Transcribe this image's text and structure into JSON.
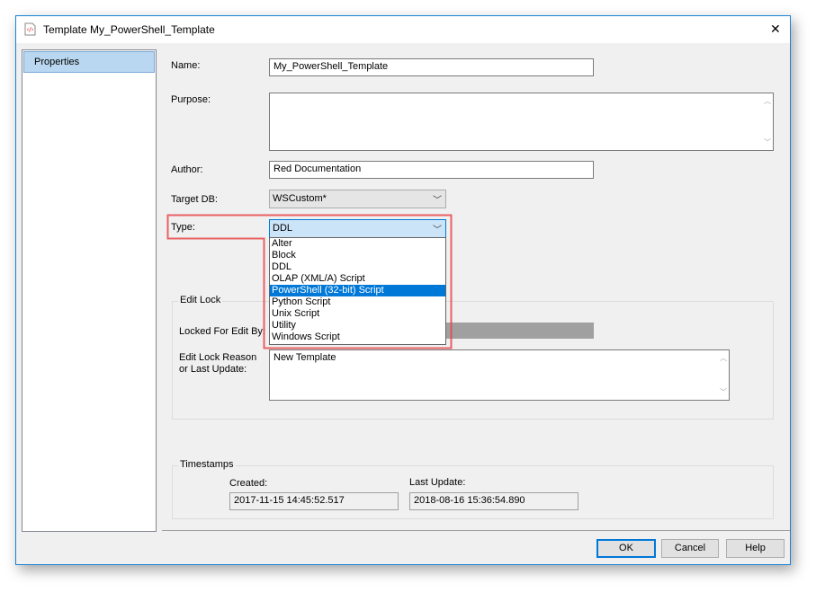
{
  "window": {
    "title": "Template My_PowerShell_Template",
    "close": "✕"
  },
  "sidebar": {
    "items": [
      {
        "label": "Properties"
      }
    ]
  },
  "form": {
    "name_label": "Name:",
    "name_value": "My_PowerShell_Template",
    "purpose_label": "Purpose:",
    "purpose_value": "",
    "author_label": "Author:",
    "author_value": "Red Documentation",
    "targetdb_label": "Target DB:",
    "targetdb_value": "WSCustom*",
    "type_label": "Type:",
    "type_value": "DDL",
    "type_options": [
      "Alter",
      "Block",
      "DDL",
      "OLAP (XML/A) Script",
      "PowerShell (32-bit) Script",
      "Python Script",
      "Unix Script",
      "Utility",
      "Windows Script"
    ],
    "type_highlighted": "PowerShell (32-bit) Script"
  },
  "edit_lock": {
    "title": "Edit Lock",
    "locked_label": "Locked For Edit By:",
    "locked_value": "",
    "reason_label_1": "Edit Lock Reason",
    "reason_label_2": "or Last Update:",
    "reason_value": "New Template"
  },
  "timestamps": {
    "title": "Timestamps",
    "created_label": "Created:",
    "created_value": "2017-11-15 14:45:52.517",
    "updated_label": "Last Update:",
    "updated_value": "2018-08-16 15:36:54.890"
  },
  "buttons": {
    "ok": "OK",
    "cancel": "Cancel",
    "help": "Help"
  },
  "colors": {
    "accent": "#0078d7",
    "highlight_box": "#e8484c",
    "selected_item": "#b9d7f0"
  }
}
